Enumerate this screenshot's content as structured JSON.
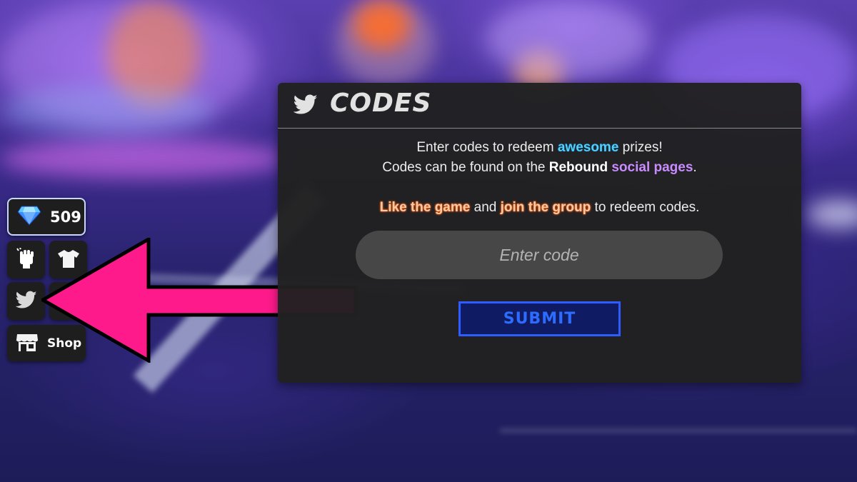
{
  "hud": {
    "gems": {
      "icon": "diamond-icon",
      "count": "509"
    },
    "buttons": [
      {
        "icon": "fist-icon"
      },
      {
        "icon": "shirt-icon"
      },
      {
        "icon": "twitter-bird-icon"
      },
      {
        "icon": "unknown-icon"
      }
    ],
    "shop": {
      "icon": "shop-icon",
      "label": "Shop"
    }
  },
  "arrow_color": "#ff1a8c",
  "codes_panel": {
    "icon": "twitter-bird-icon",
    "title": "CODES",
    "line1": {
      "pre": "Enter codes to redeem",
      "highlight": "awesome",
      "post": "prizes!"
    },
    "line2": {
      "pre": "Codes can be found on the",
      "bold": "Rebound",
      "purple": "social pages",
      "post": "."
    },
    "line3": {
      "hl1": "Like the game",
      "mid": "and",
      "hl2": "join the group",
      "post": "to redeem codes."
    },
    "input": {
      "placeholder": "Enter code",
      "value": ""
    },
    "submit_label": "SUBMIT"
  },
  "colors": {
    "panel_bg": "#212121",
    "highlight_blue": "#4fd0ff",
    "highlight_purple": "#c98cff",
    "highlight_orange": "#ff6a1a",
    "submit_border": "#2f5cff",
    "submit_text": "#2e6bff"
  }
}
